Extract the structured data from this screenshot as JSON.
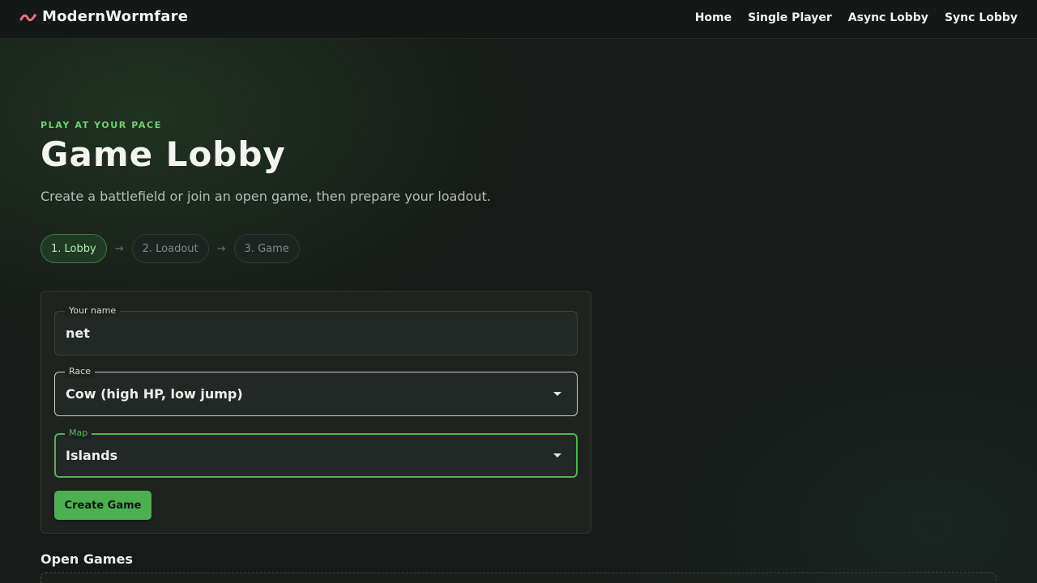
{
  "header": {
    "brand": "ModernWormfare",
    "nav": [
      "Home",
      "Single Player",
      "Async Lobby",
      "Sync Lobby"
    ],
    "brand_icon": "worm-icon"
  },
  "hero": {
    "kicker": "PLAY AT YOUR PACE",
    "title": "Game Lobby",
    "subtitle": "Create a battlefield or join an open game, then prepare your loadout."
  },
  "steps": [
    {
      "label": "1. Lobby",
      "active": true
    },
    {
      "label": "2. Loadout",
      "active": false
    },
    {
      "label": "3. Game",
      "active": false
    }
  ],
  "step_separator": "→",
  "form": {
    "name_label": "Your name",
    "name_value": "net",
    "race_label": "Race",
    "race_value": "Cow (high HP, low jump)",
    "map_label": "Map",
    "map_value": "Islands",
    "create_button": "Create Game"
  },
  "open_games": {
    "title": "Open Games"
  },
  "colors": {
    "accent": "#4caf50",
    "kicker": "#6fd26f",
    "brand_worm": "#e8707a",
    "background": "#161a18"
  }
}
